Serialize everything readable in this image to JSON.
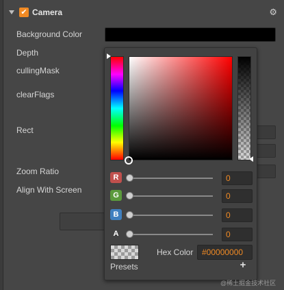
{
  "component": {
    "title": "Camera",
    "enabled_mark": "✔",
    "settings_icon": "gear-icon",
    "settings_glyph": "⚙"
  },
  "properties": {
    "background_color": "Background Color",
    "depth": "Depth",
    "culling_mask": "cullingMask",
    "clear_flags": "clearFlags",
    "rect": "Rect",
    "zoom_ratio": "Zoom Ratio",
    "align_with_screen": "Align With Screen"
  },
  "background_color_value": "#000000",
  "picker": {
    "channels": [
      {
        "badge": "R",
        "value": "0",
        "color": "#c0504d"
      },
      {
        "badge": "G",
        "value": "0",
        "color": "#5b9a3c"
      },
      {
        "badge": "B",
        "value": "0",
        "color": "#3f7fbf"
      },
      {
        "badge": "A",
        "value": "0",
        "color": "#424242"
      }
    ],
    "hex_label": "Hex Color",
    "hex_value": "#00000000",
    "presets_label": "Presets",
    "add_preset_glyph": "+"
  },
  "accent_color": "#f08a24",
  "watermark": "@稀土掘金技术社区"
}
